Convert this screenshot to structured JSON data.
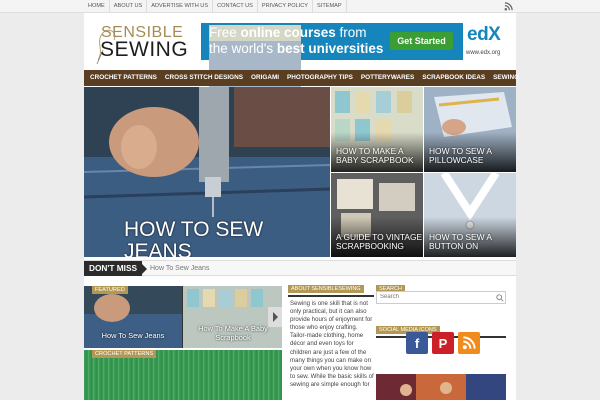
{
  "top_nav": [
    "HOME",
    "ABOUT US",
    "ADVERTISE WITH US",
    "CONTACT US",
    "PRIVACY POLICY",
    "SITEMAP"
  ],
  "logo": {
    "line1": "SENSIBLE",
    "line2": "SEWING"
  },
  "ad": {
    "line1_pre": "Free ",
    "line1_bold": "online courses",
    "line1_post": " from",
    "line2_pre": "the world's ",
    "line2_bold": "best universities",
    "button": "Get Started",
    "brand": "edX",
    "url": "www.edx.org"
  },
  "main_nav": [
    "CROCHET PATTERNS",
    "CROSS STITCH DESIGNS",
    "ORIGAMI",
    "PHOTOGRAPHY TIPS",
    "POTTERYWARES",
    "SCRAPBOOK IDEAS",
    "SEWING"
  ],
  "hero": {
    "title": "How To Sew Jeans"
  },
  "tiles": [
    {
      "title": "How To Make A Baby Scrapbook"
    },
    {
      "title": "How To Sew A Pillowcase"
    },
    {
      "title": "A Guide To Vintage Scrapbooking"
    },
    {
      "title": "How To Sew A Button On"
    }
  ],
  "dont_miss": {
    "label": "Don't Miss",
    "text": "How To Sew Jeans"
  },
  "featured": {
    "badge": "FEATURED",
    "items": [
      {
        "title": "How To Sew Jeans"
      },
      {
        "title": "How To Make A Baby Scrapbook"
      }
    ]
  },
  "crochet": {
    "badge": "CROCHET PATTERNS"
  },
  "about": {
    "heading": "ABOUT SENSIBLESEWING",
    "text": "Sewing is one skill that is not only practical, but it can also provide hours of enjoyment for those who enjoy crafting. Tailor-made clothing, home décor and even toys for children are just a few of the many things you can make on your own when you know how to sew. While the basic skills of sewing are simple enough for"
  },
  "search": {
    "heading": "SEARCH",
    "placeholder": "Search"
  },
  "social": {
    "heading": "SOCIAL MEDIA ICONS",
    "icons": [
      "facebook-icon",
      "pinterest-icon",
      "rss-icon"
    ]
  },
  "colors": {
    "nav": "#5a3e21",
    "accent": "#b39855",
    "ad": "#1585bb",
    "ad_button": "#3b9e34"
  }
}
